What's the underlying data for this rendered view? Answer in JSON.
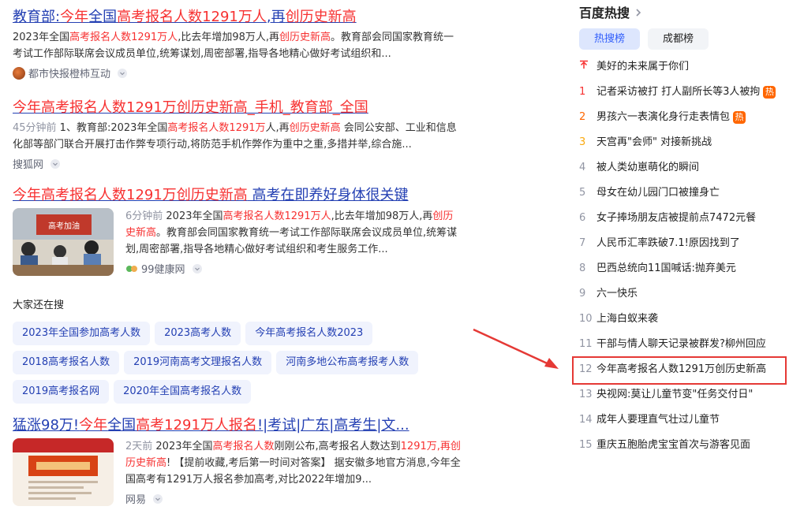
{
  "results": [
    {
      "title_parts": [
        "教育部:",
        "今年",
        "全国",
        "高考报名人数1291万人",
        ",再",
        "创历史新高",
        ""
      ],
      "abstract_parts": [
        "2023年全国",
        "高考报名人数1291万人",
        ",比去年增加98万人,再",
        "创历史新高",
        "。教育部会同国家教育统一考试工作部际联席会议成员单位,统筹谋划,周密部署,指导各地精心做好考试组织和..."
      ],
      "source": "都市快报橙柿互动"
    },
    {
      "title": "今年高考报名人数1291万创历史新高_手机_教育部_全国",
      "time": "45分钟前",
      "abstract_parts": [
        " 1、教育部:2023年全国",
        "高考报名人数1291万",
        "人,再",
        "创历史新高",
        " 会同公安部、工业和信息化部等部门联合开展打击作弊专项行动,将防范手机作弊作为重中之重,多措并举,综合施..."
      ],
      "source": "搜狐网"
    },
    {
      "title_hl": "今年高考报名人数1291万创历史新高",
      "title_rest": " 高考在即养好身体很关键",
      "time": "6分钟前",
      "abstract_parts": [
        " 2023年全国",
        "高考报名人数1291万人",
        ",比去年增加98万人,再",
        "创历史新高",
        "。教育部会同国家教育统一考试工作部际联席会议成员单位,统筹谋划,周密部署,指导各地精心做好考试组织和考生服务工作..."
      ],
      "source": "99健康网",
      "thumb_text": "高考加油"
    },
    {
      "title_parts": [
        "猛涨98万!",
        "今年",
        "全国",
        "高考1291万人报名",
        "!|考试|广东|高考生|文..."
      ],
      "time": "2天前",
      "abstract_parts": [
        " 2023年全国",
        "高考报名人数",
        "刚刚公布,高考报名人数达到",
        "1291万,再创历史新高",
        "! 【提前收藏,考后第一时间对答案】 据安徽多地官方消息,今年全国高考有1291万人报名参加高考,对比2022年增加9..."
      ],
      "source": "网易"
    }
  ],
  "also_search": {
    "label": "大家还在搜",
    "rows": [
      [
        "2023年全国参加高考人数",
        "2023高考人数",
        "今年高考报名人数2023"
      ],
      [
        "2018高考报名人数",
        "2019河南高考文理报名人数",
        "河南多地公布高考报考人数"
      ],
      [
        "2019高考报名网",
        "2020年全国高考报名人数"
      ]
    ]
  },
  "sidebar": {
    "title": "百度热搜",
    "tabs": [
      "热搜榜",
      "成都榜"
    ],
    "items": [
      {
        "rank": "↑",
        "text": "美好的未来属于你们",
        "badge": ""
      },
      {
        "rank": "1",
        "text": "记者采访被打 打人副所长等3人被拘",
        "badge": "热"
      },
      {
        "rank": "2",
        "text": "男孩六一表演化身行走表情包",
        "badge": "热"
      },
      {
        "rank": "3",
        "text": "天宫再\"会师\" 对接新挑战",
        "badge": ""
      },
      {
        "rank": "4",
        "text": "被人类幼崽萌化的瞬间",
        "badge": ""
      },
      {
        "rank": "5",
        "text": "母女在幼儿园门口被撞身亡",
        "badge": ""
      },
      {
        "rank": "6",
        "text": "女子捧场朋友店被提前点7472元餐",
        "badge": ""
      },
      {
        "rank": "7",
        "text": "人民币汇率跌破7.1!原因找到了",
        "badge": ""
      },
      {
        "rank": "8",
        "text": "巴西总统向11国喊话:抛弃美元",
        "badge": ""
      },
      {
        "rank": "9",
        "text": "六一快乐",
        "badge": ""
      },
      {
        "rank": "10",
        "text": "上海白蚁来袭",
        "badge": ""
      },
      {
        "rank": "11",
        "text": "干部与情人聊天记录被群发?柳州回应",
        "badge": ""
      },
      {
        "rank": "12",
        "text": "今年高考报名人数1291万创历史新高",
        "badge": ""
      },
      {
        "rank": "13",
        "text": "央视网:莫让儿童节变\"任务交付日\"",
        "badge": ""
      },
      {
        "rank": "14",
        "text": "成年人要理直气壮过儿童节",
        "badge": ""
      },
      {
        "rank": "15",
        "text": "重庆五胞胎虎宝宝首次与游客见面",
        "badge": ""
      }
    ]
  },
  "colors": {
    "link": "#2440b3",
    "highlight": "#f73131",
    "annotation": "#e53935"
  }
}
